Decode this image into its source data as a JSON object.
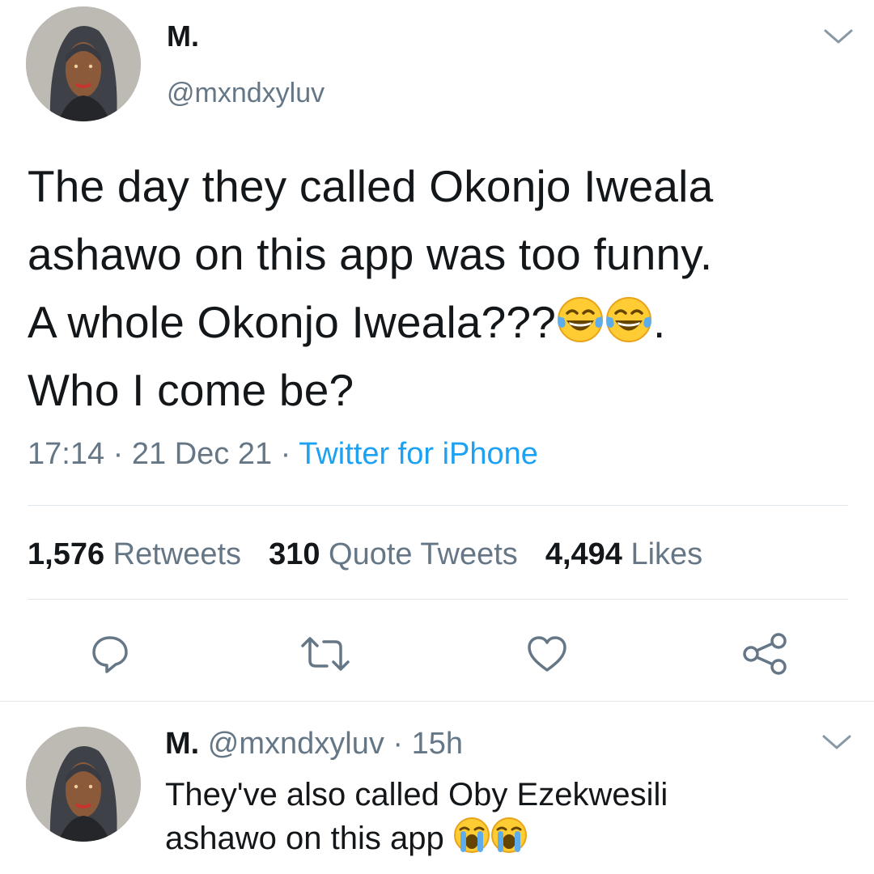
{
  "tweet": {
    "display_name": "M.",
    "handle": "@mxndxyluv",
    "text_line1": "The day they called Okonjo Iweala",
    "text_line2": "ashawo on this app was too funny.",
    "text_line3a": "A whole Okonjo Iweala???",
    "text_line3b": ".",
    "text_line4": "Who I come be?",
    "emoji_line3": [
      "face-with-tears-of-joy",
      "face-with-tears-of-joy"
    ],
    "time": "17:14",
    "sep1": "·",
    "date": "21 Dec 21",
    "sep2": "·",
    "source": "Twitter for iPhone"
  },
  "stats": {
    "retweets_count": "1,576",
    "retweets_label": "Retweets",
    "quotes_count": "310",
    "quotes_label": "Quote Tweets",
    "likes_count": "4,494",
    "likes_label": "Likes"
  },
  "actions": [
    "reply-icon",
    "retweet-icon",
    "like-icon",
    "share-icon"
  ],
  "reply": {
    "display_name": "M.",
    "handle": "@mxndxyluv",
    "sep": "·",
    "time": "15h",
    "text_line1": "They've also called Oby Ezekwesili",
    "text_line2": "ashawo on this app",
    "emoji": [
      "loudly-crying-face",
      "loudly-crying-face"
    ]
  },
  "colors": {
    "text": "#14171a",
    "secondary": "#657786",
    "link": "#1da1f2",
    "divider": "#e1e8ed"
  }
}
